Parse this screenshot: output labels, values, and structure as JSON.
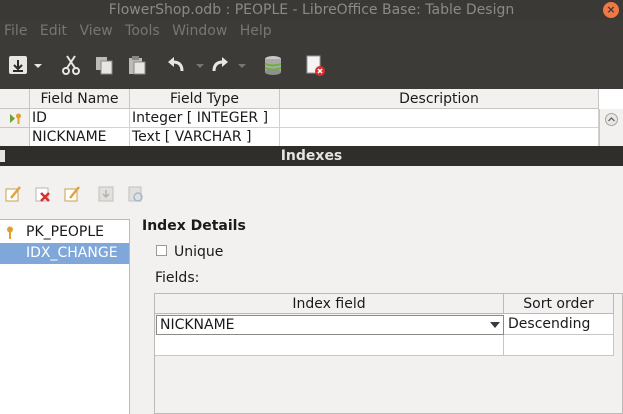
{
  "window": {
    "title": "FlowerShop.odb : PEOPLE - LibreOffice Base: Table Design"
  },
  "menu": [
    "File",
    "Edit",
    "View",
    "Tools",
    "Window",
    "Help"
  ],
  "toolbar": {
    "icons": [
      "save-icon",
      "dropdown-icon",
      "cut-icon",
      "copy-icon",
      "paste-icon",
      "undo-icon",
      "redo-icon",
      "database-icon",
      "close-document-icon"
    ]
  },
  "design_grid": {
    "headers": [
      "Field Name",
      "Field Type",
      "Description"
    ],
    "rows": [
      {
        "name": "ID",
        "type": "Integer [ INTEGER ]",
        "description": ""
      },
      {
        "name": "NICKNAME",
        "type": "Text [ VARCHAR ]",
        "description": ""
      }
    ]
  },
  "indexes_dialog": {
    "title": "Indexes",
    "indexes": [
      {
        "label": "PK_PEOPLE",
        "primary": true,
        "selected": false
      },
      {
        "label": "IDX_CHANGE",
        "primary": false,
        "selected": true
      }
    ],
    "details_title": "Index Details",
    "unique_label": "Unique",
    "unique_checked": false,
    "fields_label": "Fields:",
    "fields_table": {
      "headers": [
        "Index field",
        "Sort order"
      ],
      "rows": [
        {
          "field": "NICKNAME",
          "sort": "Descending"
        },
        {
          "field": "",
          "sort": ""
        }
      ]
    }
  },
  "colors": {
    "selection": "#7fa7d9",
    "dark_chrome": "#3c3b37",
    "close_button": "#f07746"
  }
}
